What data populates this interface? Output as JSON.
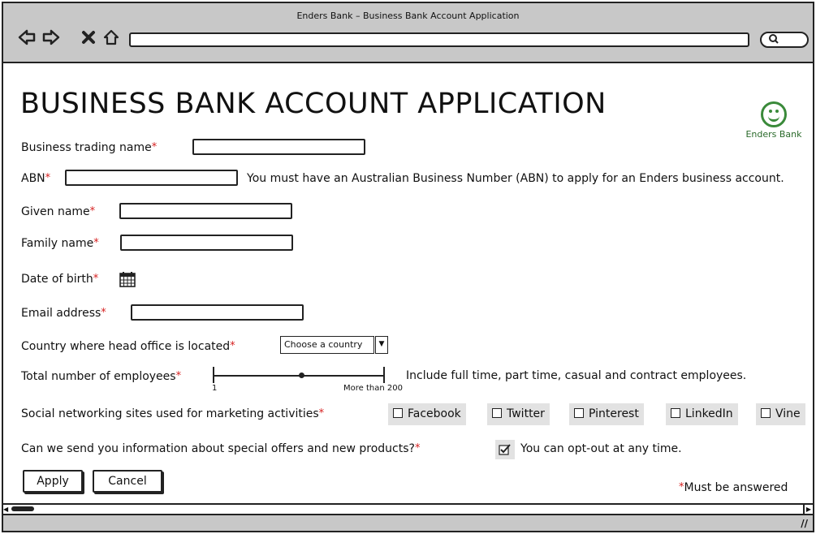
{
  "window": {
    "title": "Enders Bank – Business Bank Account Application"
  },
  "toolbar": {
    "back_icon": "back-arrow-icon",
    "forward_icon": "forward-arrow-icon",
    "stop_icon": "close-icon",
    "home_icon": "home-icon",
    "search_icon": "search-icon"
  },
  "page": {
    "title": "BUSINESS BANK ACCOUNT APPLICATION"
  },
  "logo": {
    "text": "Enders Bank",
    "icon": "smiley-icon",
    "color": "#3a8a3a"
  },
  "form": {
    "business_trading_name": {
      "label": "Business trading name",
      "value": ""
    },
    "abn": {
      "label": "ABN",
      "value": "",
      "note": "You must have an Australian Business Number (ABN) to apply for an Enders business account."
    },
    "given_name": {
      "label": "Given name",
      "value": ""
    },
    "family_name": {
      "label": "Family name",
      "value": ""
    },
    "date_of_birth": {
      "label": "Date of birth",
      "icon": "calendar-icon"
    },
    "email": {
      "label": "Email address",
      "value": ""
    },
    "country": {
      "label": "Country where head office is located",
      "selected": "Choose a country"
    },
    "employees": {
      "label": "Total number of employees",
      "min_label": "1",
      "max_label": "More than 200",
      "level": 0.52,
      "note": "Include full time, part time, casual and contract employees."
    },
    "social": {
      "label": "Social networking sites used for marketing activities",
      "options": [
        "Facebook",
        "Twitter",
        "Pinterest",
        "LinkedIn",
        "Vine"
      ]
    },
    "offers": {
      "label": "Can we send you information about special offers and new products?",
      "checked": true,
      "note": "You can opt-out at any time."
    },
    "required_marker": "*",
    "required_legend": "Must be answered"
  },
  "buttons": {
    "apply": "Apply",
    "cancel": "Cancel"
  },
  "colors": {
    "required": "#d62020",
    "chrome": "#c8c8c8",
    "chip": "#e2e2e2"
  }
}
